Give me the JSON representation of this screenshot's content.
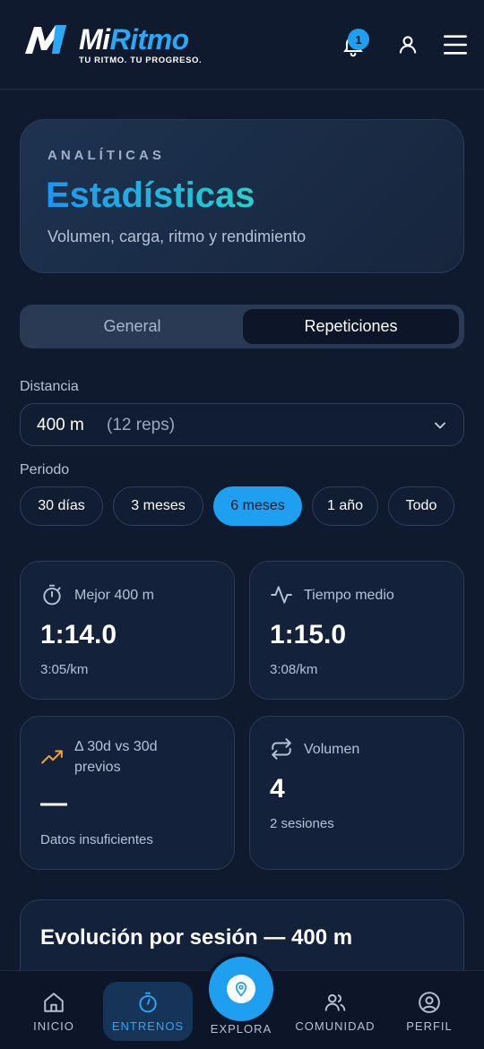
{
  "header": {
    "brand_mi": "Mi",
    "brand_ritmo": "Ritmo",
    "tagline": "TU RITMO. TU PROGRESO.",
    "notification_count": "1"
  },
  "hero": {
    "eyebrow": "ANALÍTICAS",
    "title": "Estadísticas",
    "subtitle": "Volumen, carga, ritmo y rendimiento"
  },
  "tabs": [
    {
      "label": "General",
      "active": false
    },
    {
      "label": "Repeticiones",
      "active": true
    }
  ],
  "distance": {
    "label": "Distancia",
    "value": "400 m",
    "reps": "(12 reps)"
  },
  "period": {
    "label": "Periodo",
    "options": [
      "30 días",
      "3 meses",
      "6 meses",
      "1 año",
      "Todo"
    ],
    "selected": "6 meses"
  },
  "stats": {
    "best": {
      "title": "Mejor 400 m",
      "value": "1:14.0",
      "sub": "3:05/km",
      "icon": "stopwatch-icon"
    },
    "avg": {
      "title": "Tiempo medio",
      "value": "1:15.0",
      "sub": "3:08/km",
      "icon": "pulse-icon"
    },
    "delta": {
      "title_line1": "Δ 30d vs 30d",
      "title_line2": "previos",
      "value": "—",
      "sub": "Datos insuficientes",
      "icon": "trending-up-icon"
    },
    "volume": {
      "title": "Volumen",
      "value": "4",
      "sub": "2 sesiones",
      "icon": "repeat-icon"
    }
  },
  "evolution": {
    "title": "Evolución por sesión — 400 m"
  },
  "nav": {
    "items": [
      {
        "label": "INICIO",
        "icon": "home-icon"
      },
      {
        "label": "ENTRENOS",
        "icon": "stopwatch-icon"
      },
      {
        "label": "EXPLORA",
        "icon": "map-pin-icon"
      },
      {
        "label": "COMUNIDAD",
        "icon": "users-icon"
      },
      {
        "label": "PERFIL",
        "icon": "user-circle-icon"
      }
    ],
    "active": "ENTRENOS"
  },
  "colors": {
    "background": "#0f1a2e",
    "accent": "#1e9ff0",
    "card": "#14213a",
    "trend": "#f5a623"
  }
}
